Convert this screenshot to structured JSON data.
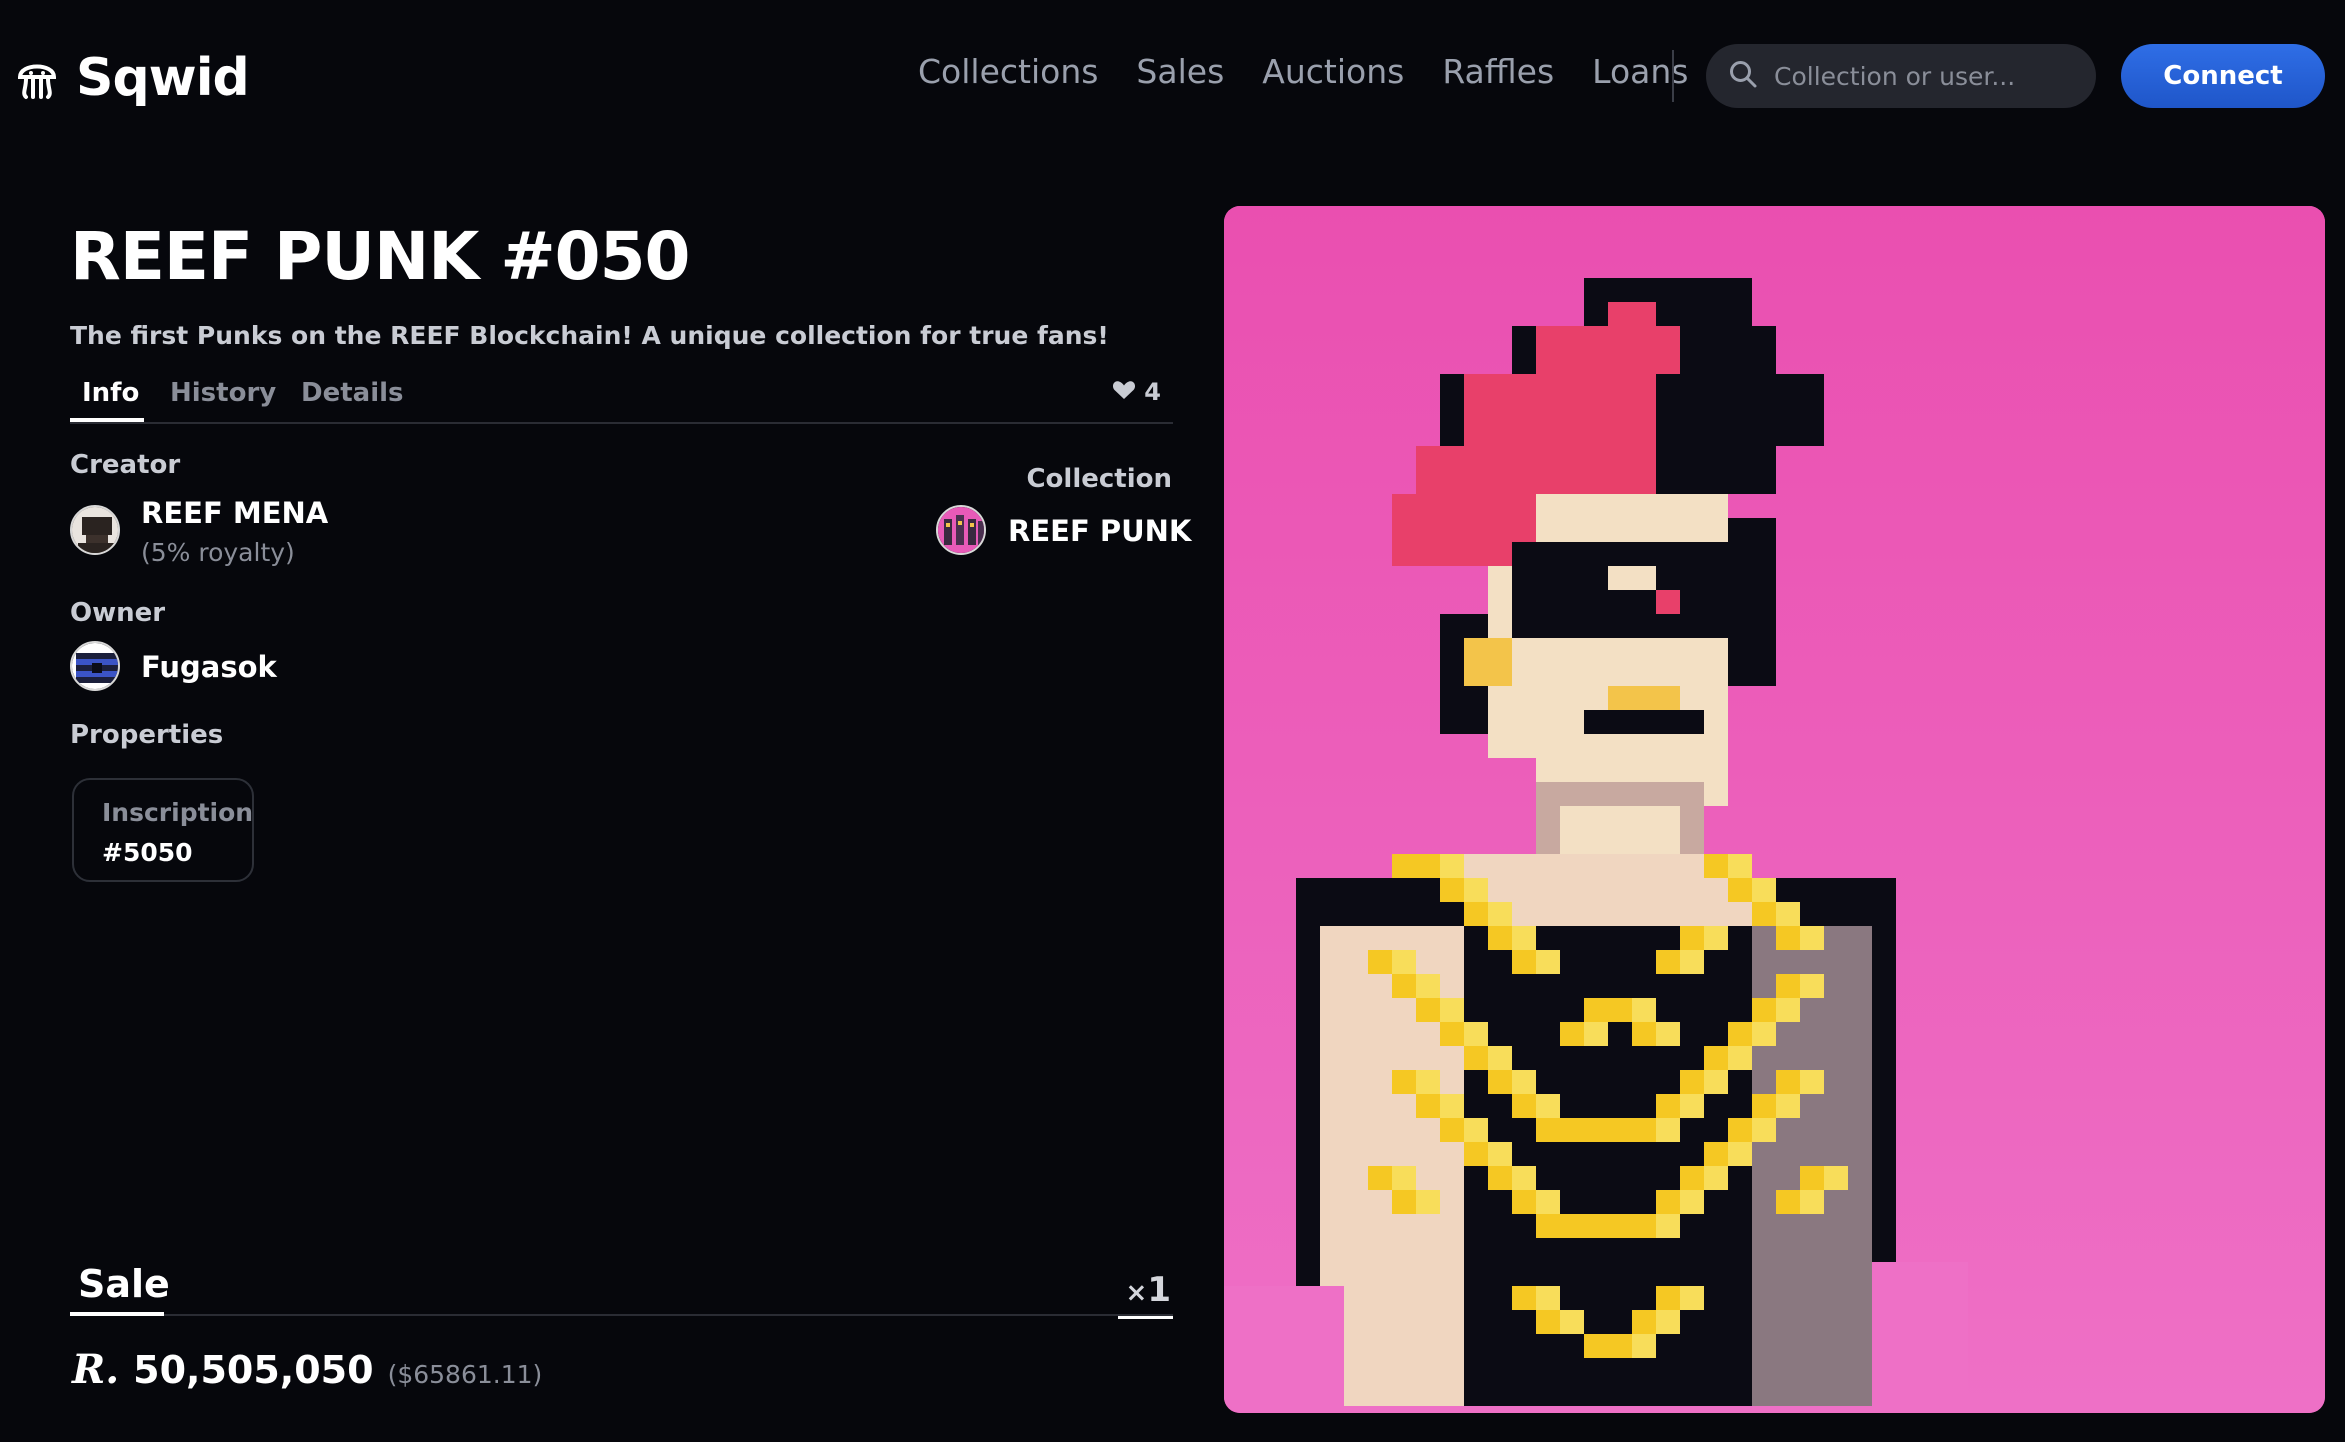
{
  "header": {
    "brand": "Sqwid",
    "nav": [
      "Collections",
      "Sales",
      "Auctions",
      "Raffles",
      "Loans"
    ],
    "search_placeholder": "Collection or user...",
    "connect_label": "Connect"
  },
  "item": {
    "title": "REEF PUNK #050",
    "description": "The first Punks on the REEF Blockchain! A unique collection for true fans!",
    "tabs": [
      "Info",
      "History",
      "Details"
    ],
    "active_tab": "Info",
    "likes": "4"
  },
  "info": {
    "creator_label": "Creator",
    "creator_name": "REEF MENA",
    "creator_royalty": "(5% royalty)",
    "collection_label": "Collection",
    "collection_name": "REEF PUNK",
    "owner_label": "Owner",
    "owner_name": "Fugasok",
    "properties_label": "Properties",
    "properties": [
      {
        "key": "Inscription",
        "value": "#5050"
      }
    ]
  },
  "sale": {
    "label": "Sale",
    "quantity_prefix": "×",
    "quantity": "1",
    "currency_symbol": "R.",
    "price": "50,505,050",
    "price_usd": "($65861.11)"
  },
  "colors": {
    "background": "#06070c",
    "accent": "#2f6ee6",
    "artwork_background": "#e85ab8"
  },
  "icons": {
    "logo": "jellyfish-icon",
    "search": "search-icon",
    "likes": "heart-icon"
  }
}
